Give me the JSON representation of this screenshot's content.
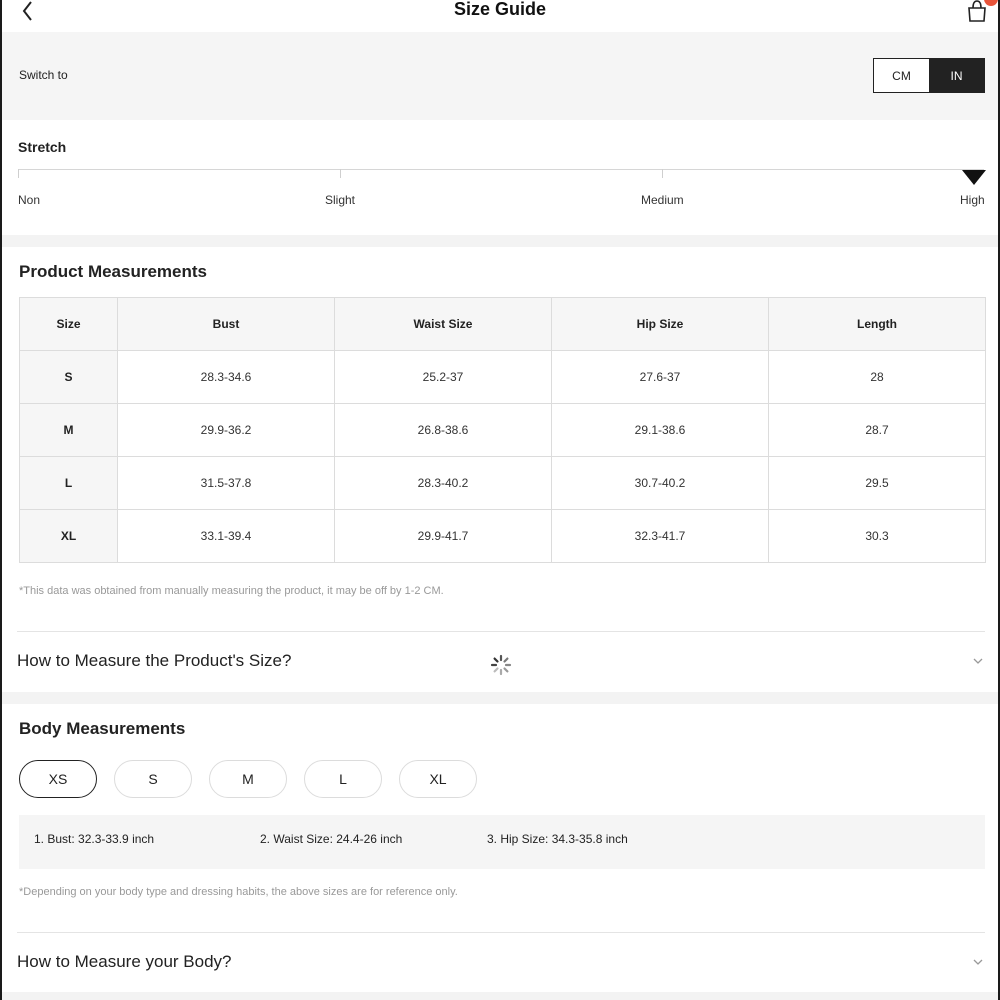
{
  "header": {
    "title": "Size Guide",
    "back_icon": "chevron-left-icon",
    "bag_icon": "shopping-bag-icon"
  },
  "unit_switch": {
    "label": "Switch to",
    "options": [
      "CM",
      "IN"
    ],
    "selected": "IN"
  },
  "stretch": {
    "title": "Stretch",
    "levels": [
      "Non",
      "Slight",
      "Medium",
      "High"
    ],
    "selected": "High"
  },
  "product": {
    "title": "Product Measurements",
    "columns": [
      "Size",
      "Bust",
      "Waist Size",
      "Hip Size",
      "Length"
    ],
    "rows": [
      [
        "S",
        "28.3-34.6",
        "25.2-37",
        "27.6-37",
        "28"
      ],
      [
        "M",
        "29.9-36.2",
        "26.8-38.6",
        "29.1-38.6",
        "28.7"
      ],
      [
        "L",
        "31.5-37.8",
        "28.3-40.2",
        "30.7-40.2",
        "29.5"
      ],
      [
        "XL",
        "33.1-39.4",
        "29.9-41.7",
        "32.3-41.7",
        "30.3"
      ]
    ],
    "note": "*This data was obtained from manually measuring the product, it may be off by 1-2 CM.",
    "accordion_label": "How to Measure the Product's Size?"
  },
  "body": {
    "title": "Body Measurements",
    "sizes": [
      "XS",
      "S",
      "M",
      "L",
      "XL"
    ],
    "selected_size": "XS",
    "measurements": [
      "1. Bust: 32.3-33.9 inch",
      "2. Waist Size: 24.4-26 inch",
      "3. Hip Size: 34.3-35.8 inch"
    ],
    "note": "*Depending on your body type and dressing habits, the above sizes are for reference only.",
    "accordion_label": "How to Measure your Body?"
  },
  "colors": {
    "accent_dark": "#222222",
    "badge": "#e8543a",
    "band": "#f5f5f5"
  }
}
